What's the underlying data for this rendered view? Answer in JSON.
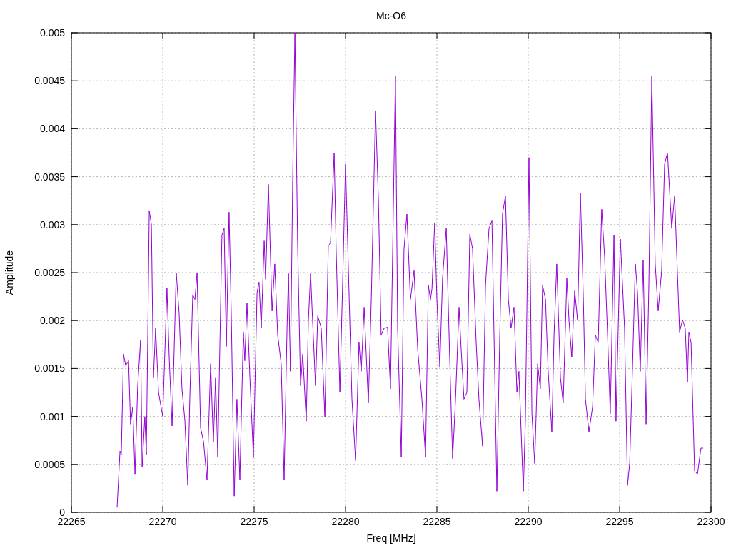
{
  "chart": {
    "chart_data": {
      "type": "line",
      "title": "Mc-O6",
      "xlabel": "Freq [MHz]",
      "ylabel": "Amplitude",
      "grid": true,
      "xlim": [
        22265,
        22300
      ],
      "ylim": [
        0,
        0.005
      ],
      "xticks": [
        {
          "value": 22265,
          "label": "22265"
        },
        {
          "value": 22270,
          "label": "22270"
        },
        {
          "value": 22275,
          "label": "22275"
        },
        {
          "value": 22280,
          "label": "22280"
        },
        {
          "value": 22285,
          "label": "22285"
        },
        {
          "value": 22290,
          "label": "22290"
        },
        {
          "value": 22295,
          "label": "22295"
        },
        {
          "value": 22300,
          "label": "22300"
        }
      ],
      "yticks": [
        {
          "value": 0,
          "label": "0"
        },
        {
          "value": 0.0005,
          "label": "0.0005"
        },
        {
          "value": 0.001,
          "label": "0.001"
        },
        {
          "value": 0.0015,
          "label": "0.0015"
        },
        {
          "value": 0.002,
          "label": "0.002"
        },
        {
          "value": 0.0025,
          "label": "0.0025"
        },
        {
          "value": 0.003,
          "label": "0.003"
        },
        {
          "value": 0.0035,
          "label": "0.0035"
        },
        {
          "value": 0.004,
          "label": "0.004"
        },
        {
          "value": 0.0045,
          "label": "0.0045"
        },
        {
          "value": 0.005,
          "label": "0.005"
        }
      ],
      "x": [
        22267.5,
        22267.66,
        22267.73,
        22267.85,
        22267.97,
        22268.13,
        22268.24,
        22268.36,
        22268.48,
        22268.63,
        22268.79,
        22268.87,
        22269.02,
        22269.1,
        22269.26,
        22269.38,
        22269.49,
        22269.61,
        22269.77,
        22270,
        22270.23,
        22270.35,
        22270.51,
        22270.74,
        22270.9,
        22271.05,
        22271.21,
        22271.37,
        22271.48,
        22271.64,
        22271.76,
        22271.88,
        22272.07,
        22272.23,
        22272.42,
        22272.62,
        22272.77,
        22272.89,
        22273.01,
        22273.24,
        22273.36,
        22273.48,
        22273.63,
        22273.75,
        22273.91,
        22274.06,
        22274.22,
        22274.41,
        22274.49,
        22274.61,
        22274.77,
        22274.96,
        22275.16,
        22275.27,
        22275.39,
        22275.55,
        22275.63,
        22275.78,
        22275.98,
        22276.13,
        22276.29,
        22276.48,
        22276.64,
        22276.8,
        22276.88,
        22276.99,
        22277.11,
        22277.23,
        22277.38,
        22277.54,
        22277.66,
        22277.85,
        22277.97,
        22278.09,
        22278.2,
        22278.36,
        22278.48,
        22278.67,
        22278.87,
        22279.06,
        22279.18,
        22279.38,
        22279.49,
        22279.69,
        22279.84,
        22280,
        22280.16,
        22280.35,
        22280.55,
        22280.74,
        22280.86,
        22281.02,
        22281.25,
        22281.41,
        22281.64,
        22281.8,
        22281.95,
        22282.11,
        22282.3,
        22282.46,
        22282.73,
        22282.85,
        22283.05,
        22283.2,
        22283.36,
        22283.55,
        22283.75,
        22283.95,
        22284.18,
        22284.38,
        22284.53,
        22284.65,
        22284.73,
        22284.88,
        22285,
        22285.16,
        22285.31,
        22285.51,
        22285.7,
        22285.86,
        22286.02,
        22286.21,
        22286.33,
        22286.48,
        22286.64,
        22286.8,
        22286.95,
        22287.15,
        22287.3,
        22287.5,
        22287.66,
        22287.85,
        22288.01,
        22288.28,
        22288.44,
        22288.59,
        22288.75,
        22288.91,
        22289.06,
        22289.22,
        22289.38,
        22289.49,
        22289.73,
        22289.84,
        22290.04,
        22290.2,
        22290.35,
        22290.51,
        22290.66,
        22290.78,
        22290.94,
        22291.09,
        22291.29,
        22291.41,
        22291.56,
        22291.76,
        22291.91,
        22292.11,
        22292.23,
        22292.38,
        22292.54,
        22292.7,
        22292.85,
        22293.01,
        22293.13,
        22293.32,
        22293.52,
        22293.67,
        22293.83,
        22294.02,
        22294.18,
        22294.34,
        22294.49,
        22294.69,
        22294.8,
        22295.04,
        22295.16,
        22295.27,
        22295.43,
        22295.55,
        22295.7,
        22295.86,
        22295.98,
        22296.13,
        22296.29,
        22296.45,
        22296.6,
        22296.76,
        22296.95,
        22297.11,
        22297.3,
        22297.46,
        22297.62,
        22297.85,
        22298.01,
        22298.16,
        22298.28,
        22298.44,
        22298.59,
        22298.71,
        22298.79,
        22298.91,
        22299.1,
        22299.26,
        22299.45,
        22299.57
      ],
      "series": [
        {
          "color": "#9400d3",
          "values": [
            5e-05,
            0.00064,
            0.0006,
            0.00165,
            0.00153,
            0.00158,
            0.00092,
            0.0011,
            0.0004,
            0.00132,
            0.0018,
            0.00047,
            0.001,
            0.0006,
            0.00314,
            0.003,
            0.0014,
            0.00192,
            0.00125,
            0.001,
            0.00234,
            0.00162,
            0.0009,
            0.0025,
            0.00207,
            0.00129,
            0.00096,
            0.00028,
            0.00118,
            0.00227,
            0.00222,
            0.0025,
            0.00088,
            0.00074,
            0.00034,
            0.00155,
            0.00073,
            0.0014,
            0.00058,
            0.00289,
            0.00296,
            0.00173,
            0.00313,
            0.00207,
            0.00017,
            0.00118,
            0.00034,
            0.00188,
            0.00158,
            0.00218,
            0.0014,
            0.00058,
            0.00229,
            0.0024,
            0.00192,
            0.00283,
            0.00243,
            0.00342,
            0.0021,
            0.00259,
            0.00185,
            0.00155,
            0.00034,
            0.00192,
            0.00249,
            0.00147,
            0.00348,
            0.005,
            0.00281,
            0.00132,
            0.00165,
            0.00095,
            0.002,
            0.00249,
            0.002,
            0.00132,
            0.00205,
            0.00192,
            0.00099,
            0.00278,
            0.00281,
            0.00375,
            0.00274,
            0.00125,
            0.00237,
            0.00363,
            0.00252,
            0.00118,
            0.00054,
            0.00177,
            0.00147,
            0.00214,
            0.00114,
            0.00222,
            0.00419,
            0.00326,
            0.00185,
            0.00192,
            0.00193,
            0.00129,
            0.00455,
            0.00192,
            0.00058,
            0.00274,
            0.00311,
            0.00222,
            0.00252,
            0.0017,
            0.00118,
            0.00058,
            0.00237,
            0.00222,
            0.00233,
            0.00302,
            0.00222,
            0.00151,
            0.00244,
            0.00296,
            0.00162,
            0.00056,
            0.00118,
            0.00214,
            0.0017,
            0.00118,
            0.00125,
            0.0029,
            0.00275,
            0.00177,
            0.00118,
            0.00069,
            0.00237,
            0.00296,
            0.00304,
            0.00022,
            0.00185,
            0.00311,
            0.0033,
            0.00222,
            0.00192,
            0.00214,
            0.00125,
            0.00147,
            0.00022,
            0.00095,
            0.0037,
            0.00103,
            0.00051,
            0.00155,
            0.00129,
            0.00237,
            0.00222,
            0.00147,
            0.00084,
            0.00185,
            0.00259,
            0.0014,
            0.00114,
            0.00244,
            0.002,
            0.00162,
            0.00231,
            0.002,
            0.00333,
            0.00225,
            0.00118,
            0.00084,
            0.0011,
            0.00185,
            0.00177,
            0.00316,
            0.00266,
            0.00185,
            0.00103,
            0.00289,
            0.00095,
            0.00285,
            0.00237,
            0.00192,
            0.00028,
            0.00051,
            0.00147,
            0.00259,
            0.00229,
            0.00147,
            0.00263,
            0.00092,
            0.00237,
            0.00455,
            0.00259,
            0.0021,
            0.00252,
            0.00363,
            0.00375,
            0.00296,
            0.0033,
            0.00252,
            0.00188,
            0.00201,
            0.00192,
            0.00136,
            0.00188,
            0.00177,
            0.00043,
            0.0004,
            0.00067,
            0.00067
          ]
        }
      ]
    }
  }
}
